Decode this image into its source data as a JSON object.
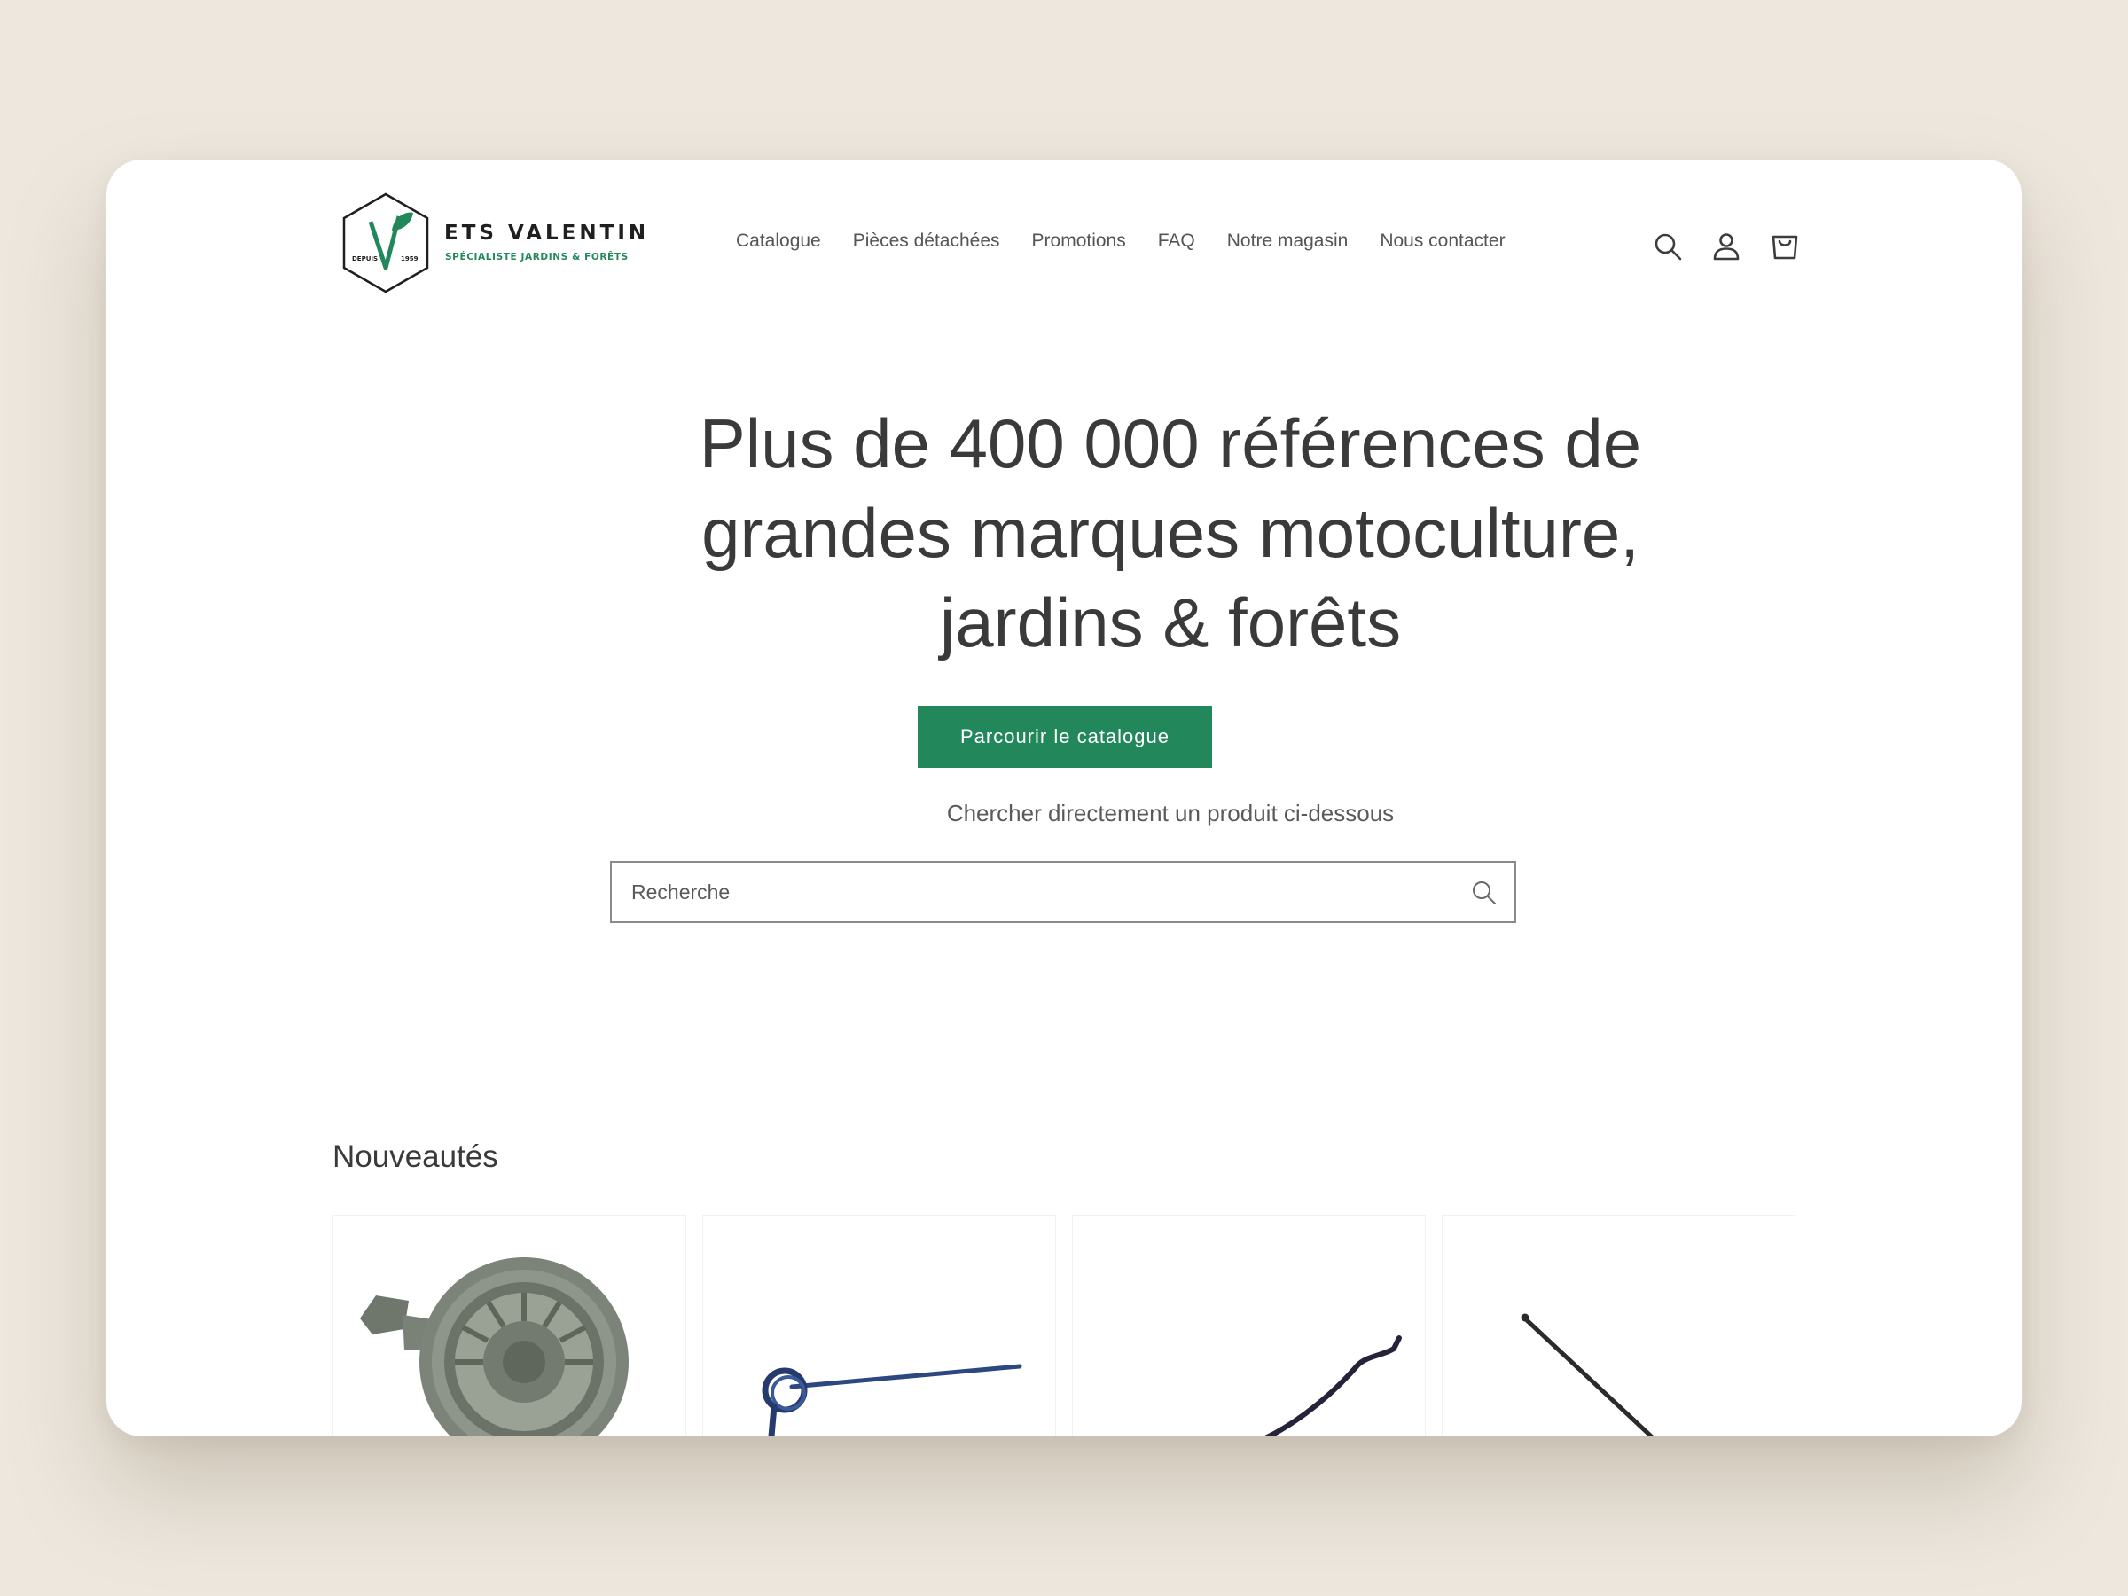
{
  "brand": {
    "name": "ETS VALENTIN",
    "tagline": "SPÉCIALISTE JARDINS & FORÊTS",
    "badge_left": "DEPUIS",
    "badge_right": "1959",
    "color": "#22875b"
  },
  "nav": {
    "items": [
      {
        "label": "Catalogue"
      },
      {
        "label": "Pièces détachées"
      },
      {
        "label": "Promotions"
      },
      {
        "label": "FAQ"
      },
      {
        "label": "Notre magasin"
      },
      {
        "label": "Nous contacter"
      }
    ]
  },
  "header_icons": [
    "search-icon",
    "account-icon",
    "cart-icon"
  ],
  "hero": {
    "title": "Plus de 400 000 références de grandes marques motoculture, jardins & forêts",
    "cta_label": "Parcourir le catalogue",
    "search_hint": "Chercher directement un produit ci-dessous",
    "search_placeholder": "Recherche"
  },
  "new_arrivals": {
    "title": "Nouveautés",
    "products": [
      {
        "image": "recoil-starter"
      },
      {
        "image": "torsion-spring-rod"
      },
      {
        "image": "bent-metal-rod"
      },
      {
        "image": "straight-metal-rod"
      }
    ]
  },
  "colors": {
    "accent": "#22875b",
    "background": "#ede7de",
    "text": "#3d3d3d"
  }
}
